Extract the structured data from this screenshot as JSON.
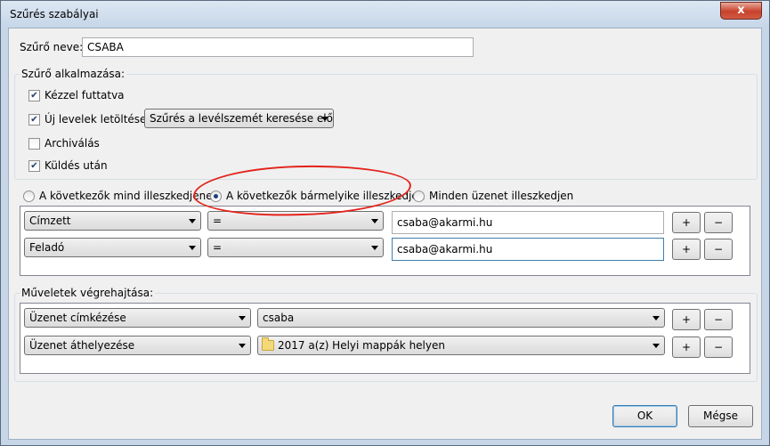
{
  "window": {
    "title": "Szűrés szabályai",
    "close_symbol": "x"
  },
  "filter_name": {
    "label": "Szűrő neve:",
    "value": "CSABA"
  },
  "apply_group": {
    "title": "Szűrő alkalmazása:",
    "manual": {
      "label": "Kézzel futtatva",
      "checked": true
    },
    "new_mail": {
      "label": "Új levelek letöltése:",
      "checked": true,
      "select_value": "Szűrés a levélszemét keresése előtt"
    },
    "archive": {
      "label": "Archiválás",
      "checked": false
    },
    "after_send": {
      "label": "Küldés után",
      "checked": true
    }
  },
  "match": {
    "all": {
      "label": "A következők mind illeszkedjenek",
      "selected": false
    },
    "any": {
      "label": "A következők bármelyike illeszkedjen",
      "selected": true
    },
    "every": {
      "label": "Minden üzenet illeszkedjen",
      "selected": false
    }
  },
  "conditions": [
    {
      "field": "Címzett",
      "operator": "=",
      "value": "csaba@akarmi.hu"
    },
    {
      "field": "Feladó",
      "operator": "=",
      "value": "csaba@akarmi.hu"
    }
  ],
  "actions_group": {
    "title": "Műveletek végrehajtása:",
    "actions": [
      {
        "action": "Üzenet címkézése",
        "target": "csaba",
        "target_icon": ""
      },
      {
        "action": "Üzenet áthelyezése",
        "target": "2017 a(z) Helyi mappák helyen",
        "target_icon": "folder-icon"
      }
    ]
  },
  "row_buttons": {
    "add": "+",
    "remove": "−"
  },
  "footer": {
    "ok": "OK",
    "cancel": "Mégse"
  },
  "colors": {
    "annotation": "#e3231b",
    "window_frame": "#c7d6e7",
    "dialog_bg": "#f0f0f0"
  }
}
